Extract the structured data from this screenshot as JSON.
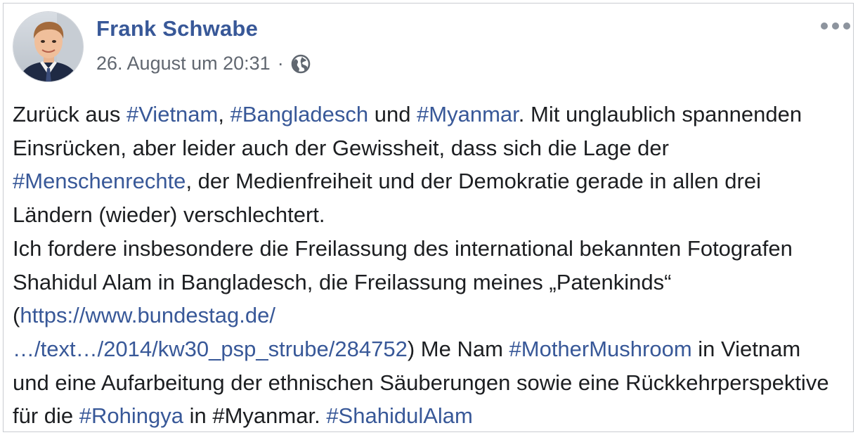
{
  "author": {
    "name": "Frank Schwabe"
  },
  "meta": {
    "timestamp": "26. August um 20:31",
    "separator": "·",
    "audience_icon": "globe-icon"
  },
  "menu": {
    "icon": "more-options-icon"
  },
  "colors": {
    "link": "#385898",
    "text": "#1c1e21",
    "meta": "#616770"
  },
  "post": {
    "p1": {
      "t1": "Zurück aus ",
      "tag_vietnam": "#Vietnam",
      "t2": ", ",
      "tag_bangladesch": "#Bangladesch",
      "t3": " und ",
      "tag_myanmar": "#Myanmar",
      "t4": ". Mit unglaublich spannenden Einsrücken, aber leider auch der Gewissheit, dass sich die Lage der ",
      "tag_menschenrechte": "#Menschenrechte",
      "t5": ", der Medienfreiheit und der Demokratie gerade in allen drei Ländern (wieder) verschlechtert."
    },
    "p2": {
      "t1": "Ich fordere insbesondere die Freilassung des international bekannten Fotografen Shahidul Alam in Bangladesch, die Freilassung meines „Patenkinds“ (",
      "link_line1": "https://www.bundestag.de/",
      "link_line2": "…/text…/2014/kw30_psp_strube/284752",
      "t2": ") Me Nam ",
      "tag_mothermushroom": "#MotherMushroom",
      "t3": " in Vietnam und eine Aufarbeitung der ethnischen Säuberungen sowie eine Rückkehrperspektive für die ",
      "tag_rohingya": "#Rohingya",
      "t4": " in #Myanmar. ",
      "tag_shahidulalam": "#ShahidulAlam"
    }
  }
}
